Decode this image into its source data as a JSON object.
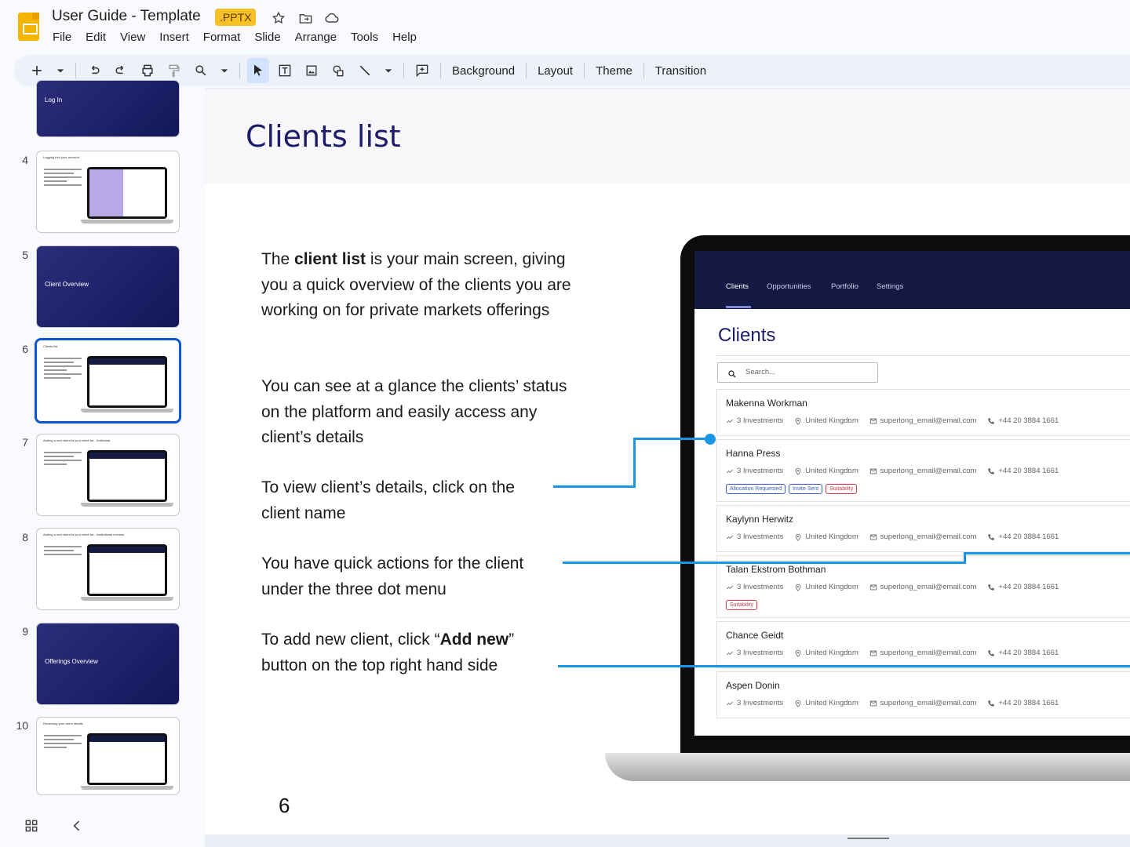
{
  "app": {
    "doc_title": "User Guide - Template",
    "badge": ".PPTX",
    "menu": [
      "File",
      "Edit",
      "View",
      "Insert",
      "Format",
      "Slide",
      "Arrange",
      "Tools",
      "Help"
    ]
  },
  "toolbar": {
    "background": "Background",
    "layout": "Layout",
    "theme": "Theme",
    "transition": "Transition"
  },
  "thumbnails": [
    {
      "num": "",
      "label": "Log In",
      "type": "dark"
    },
    {
      "num": "4",
      "title": "Logging into your account",
      "type": "content"
    },
    {
      "num": "5",
      "label": "Client Overview",
      "type": "dark"
    },
    {
      "num": "6",
      "title": "Clients list",
      "type": "content",
      "selected": true
    },
    {
      "num": "7",
      "title": "Adding a new client to your client list - Individual",
      "type": "content"
    },
    {
      "num": "8",
      "title": "Adding a new client to your client list - Institutional investor",
      "type": "content"
    },
    {
      "num": "9",
      "label": "Offerings Overview",
      "type": "dark"
    },
    {
      "num": "10",
      "title": "Reviewing your client details",
      "type": "content"
    }
  ],
  "slide": {
    "title": "Clients list",
    "p1_pre": "The ",
    "p1_bold": "client list",
    "p1_post": " is your main screen, giving you a quick overview of the clients you are working on for private markets offerings",
    "p2": "You can see at a glance the clients’ status on the platform and easily access any client’s details",
    "p3": "To view client’s details, click on the client name",
    "p4": "You have quick actions for the client under the three dot menu",
    "p5_pre": "To add new client, click “",
    "p5_bold": "Add new",
    "p5_post": "” button on the top right hand side",
    "page_number": "6"
  },
  "screen": {
    "nav": [
      "Clients",
      "Opportunities",
      "Portfolio",
      "Settings"
    ],
    "heading": "Clients",
    "search_placeholder": "Search...",
    "clients": [
      {
        "name": "Makenna Workman",
        "investments": "3 Investments",
        "country": "United Kingdom",
        "email": "superlong_email@email.com",
        "phone": "+44 20 3884 1661",
        "tags": []
      },
      {
        "name": "Hanna Press",
        "investments": "3 Investments",
        "country": "United Kingdom",
        "email": "superlong_email@email.com",
        "phone": "+44 20 3884 1661",
        "tags": [
          {
            "text": "Allocation Requested",
            "color": "blue"
          },
          {
            "text": "Invite Sent",
            "color": "blue"
          },
          {
            "text": "Suitability",
            "color": "red"
          }
        ]
      },
      {
        "name": "Kaylynn Herwitz",
        "investments": "3 Investments",
        "country": "United Kingdom",
        "email": "superlong_email@email.com",
        "phone": "+44 20 3884 1661",
        "tags": []
      },
      {
        "name": "Talan Ekstrom Bothman",
        "investments": "3 Investments",
        "country": "United Kingdom",
        "email": "superlong_email@email.com",
        "phone": "+44 20 3884 1661",
        "tags": [
          {
            "text": "Suitability",
            "color": "red"
          }
        ]
      },
      {
        "name": "Chance Geidt",
        "investments": "3 Investments",
        "country": "United Kingdom",
        "email": "superlong_email@email.com",
        "phone": "+44 20 3884 1661",
        "tags": []
      },
      {
        "name": "Aspen Donin",
        "investments": "3 Investments",
        "country": "United Kingdom",
        "email": "superlong_email@email.com",
        "phone": "+44 20 3884 1661",
        "tags": []
      }
    ]
  },
  "colors": {
    "accent": "#0b57d0",
    "slide_title": "#1e1b6b",
    "callout": "#1a94e4",
    "app_nav": "#151a45"
  }
}
